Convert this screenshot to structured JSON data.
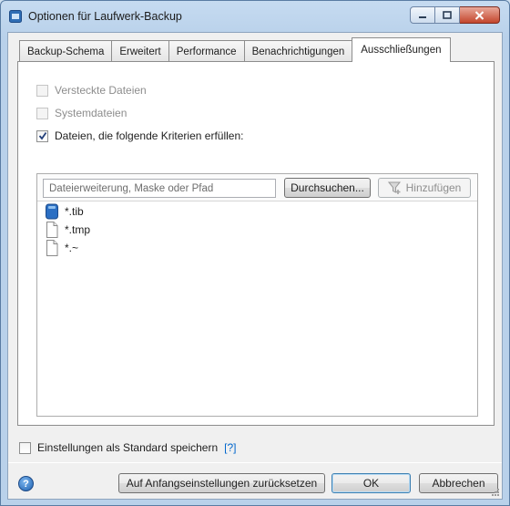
{
  "window": {
    "title": "Optionen für Laufwerk-Backup"
  },
  "tabs": [
    {
      "label": "Backup-Schema",
      "active": false
    },
    {
      "label": "Erweitert",
      "active": false
    },
    {
      "label": "Performance",
      "active": false
    },
    {
      "label": "Benachrichtigungen",
      "active": false
    },
    {
      "label": "Ausschließungen",
      "active": true
    }
  ],
  "exclusions": {
    "hidden_files": {
      "label": "Versteckte Dateien",
      "checked": false,
      "enabled": false
    },
    "system_files": {
      "label": "Systemdateien",
      "checked": false,
      "enabled": false
    },
    "criteria_files": {
      "label": "Dateien, die folgende Kriterien erfüllen:",
      "checked": true,
      "enabled": true
    },
    "path_input": {
      "placeholder": "Dateierweiterung, Maske oder Pfad",
      "value": ""
    },
    "browse_label": "Durchsuchen...",
    "add_label": "Hinzufügen",
    "items": [
      {
        "label": "*.tib",
        "icon": "tib-file-icon"
      },
      {
        "label": "*.tmp",
        "icon": "file-icon"
      },
      {
        "label": "*.~",
        "icon": "file-icon"
      }
    ]
  },
  "footer": {
    "save_default_label": "Einstellungen als Standard speichern",
    "help_link": "[?]",
    "reset_label": "Auf Anfangseinstellungen zurücksetzen",
    "ok_label": "OK",
    "cancel_label": "Abbrechen"
  }
}
